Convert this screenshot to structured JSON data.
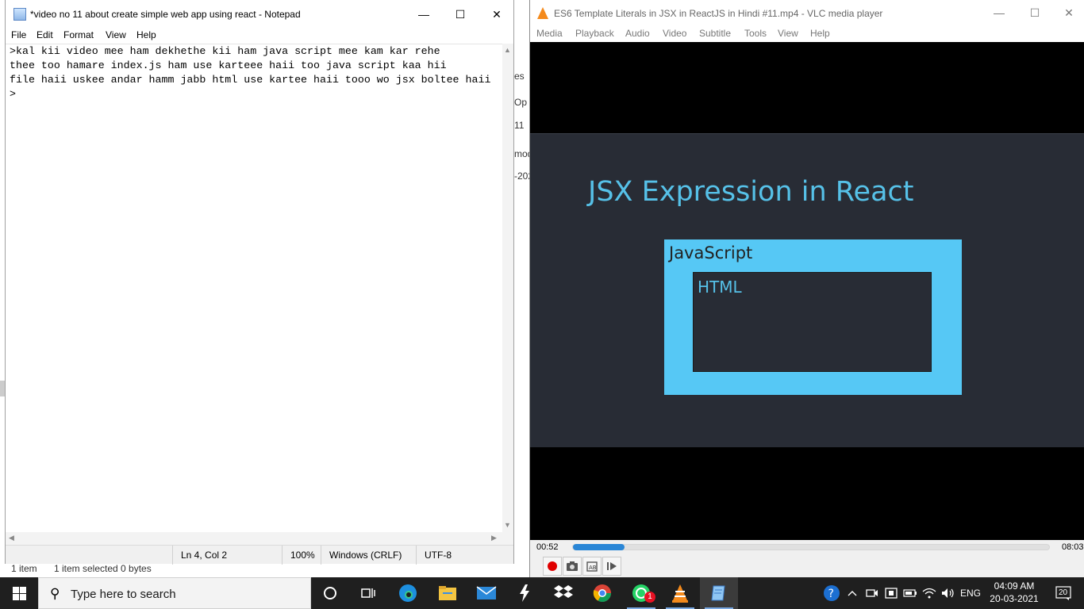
{
  "background_window": {
    "status_items_count": "1 item",
    "status_items_selected": "1 item selected  0 bytes",
    "peek_fragments": [
      "es",
      "Op",
      "11",
      "mod",
      "-202"
    ]
  },
  "notepad": {
    "title": "*video no 11 about create simple web app using react - Notepad",
    "window_controls": {
      "minimize": "—",
      "maximize": "☐",
      "close": "✕"
    },
    "menu": [
      "File",
      "Edit",
      "Format",
      "View",
      "Help"
    ],
    "content": ">kal kii video mee ham dekhethe kii ham java script mee kam kar rehe\nthee too hamare index.js ham use karteee haii too java script kaa hii\nfile haii uskee andar hamm jabb html use kartee haii tooo wo jsx boltee haii\n>",
    "status": {
      "position": "Ln 4, Col 2",
      "zoom": "100%",
      "line_ending": "Windows (CRLF)",
      "encoding": "UTF-8"
    }
  },
  "vlc": {
    "title": "ES6 Template Literals in JSX in ReactJS in Hindi #11.mp4 - VLC media player",
    "window_controls": {
      "minimize": "—",
      "maximize": "☐",
      "close": "✕"
    },
    "menu": [
      "Media",
      "Playback",
      "Audio",
      "Video",
      "Subtitle",
      "Tools",
      "View",
      "Help"
    ],
    "slide": {
      "title": "JSX Expression in React",
      "outer_label": "JavaScript",
      "inner_label": "HTML"
    },
    "time_elapsed": "00:52",
    "time_total": "08:03",
    "progress_fraction": 0.108,
    "controls": [
      "record-icon",
      "snapshot-icon",
      "loop-ab-icon",
      "frame-step-icon"
    ]
  },
  "taskbar": {
    "search_placeholder": "Type here to search",
    "pinned": [
      "cortana-icon",
      "task-view-icon",
      "edge-icon",
      "file-explorer-icon",
      "mail-icon",
      "winamp-icon",
      "dropbox-icon",
      "chrome-icon",
      "whatsapp-icon",
      "vlc-icon",
      "notepad-icon"
    ],
    "whatsapp_badge": "1",
    "tray": {
      "language": "ENG",
      "time": "04:09 AM",
      "date": "20-03-2021",
      "notifications": "20"
    }
  },
  "colors": {
    "slide_background": "#282c35",
    "slide_accent": "#56c8f5",
    "seek_fill": "#2a86d6",
    "taskbar": "#1f1f1f"
  }
}
